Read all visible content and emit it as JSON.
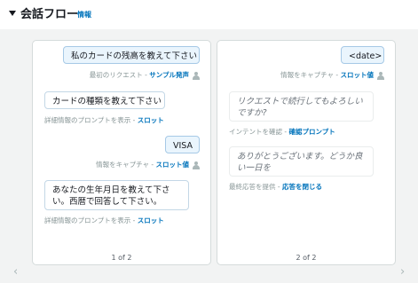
{
  "header": {
    "title": "会話フロー",
    "info_link": "情報"
  },
  "panel1": {
    "page": "1 of 2",
    "messages": [
      {
        "text": "私のカードの残高を教えて下さい",
        "meta_prefix": "最初のリクエスト - ",
        "meta_link": "サンプル発声"
      },
      {
        "text": "カードの種類を教えて下さい",
        "meta_prefix": "詳細情報のプロンプトを表示 - ",
        "meta_link": "スロット"
      },
      {
        "text": "VISA",
        "meta_prefix": "情報をキャプチャ - ",
        "meta_link": "スロット値"
      },
      {
        "text": "あなたの生年月日を教えて下さい。西暦で回答して下さい。",
        "meta_prefix": "詳細情報のプロンプトを表示 - ",
        "meta_link": "スロット"
      }
    ]
  },
  "panel2": {
    "page": "2 of 2",
    "messages": [
      {
        "text": "<date>",
        "meta_prefix": "情報をキャプチャ - ",
        "meta_link": "スロット値"
      },
      {
        "text": "リクエストで続行してもよろしいですか?",
        "meta_prefix": "インテントを確認 - ",
        "meta_link": "確認プロンプト"
      },
      {
        "text": "ありがとうございます。どうか良い一日を",
        "meta_prefix": "最終応答を提供 - ",
        "meta_link": "応答を閉じる"
      }
    ]
  },
  "nav": {
    "prev": "‹",
    "next": "›"
  }
}
